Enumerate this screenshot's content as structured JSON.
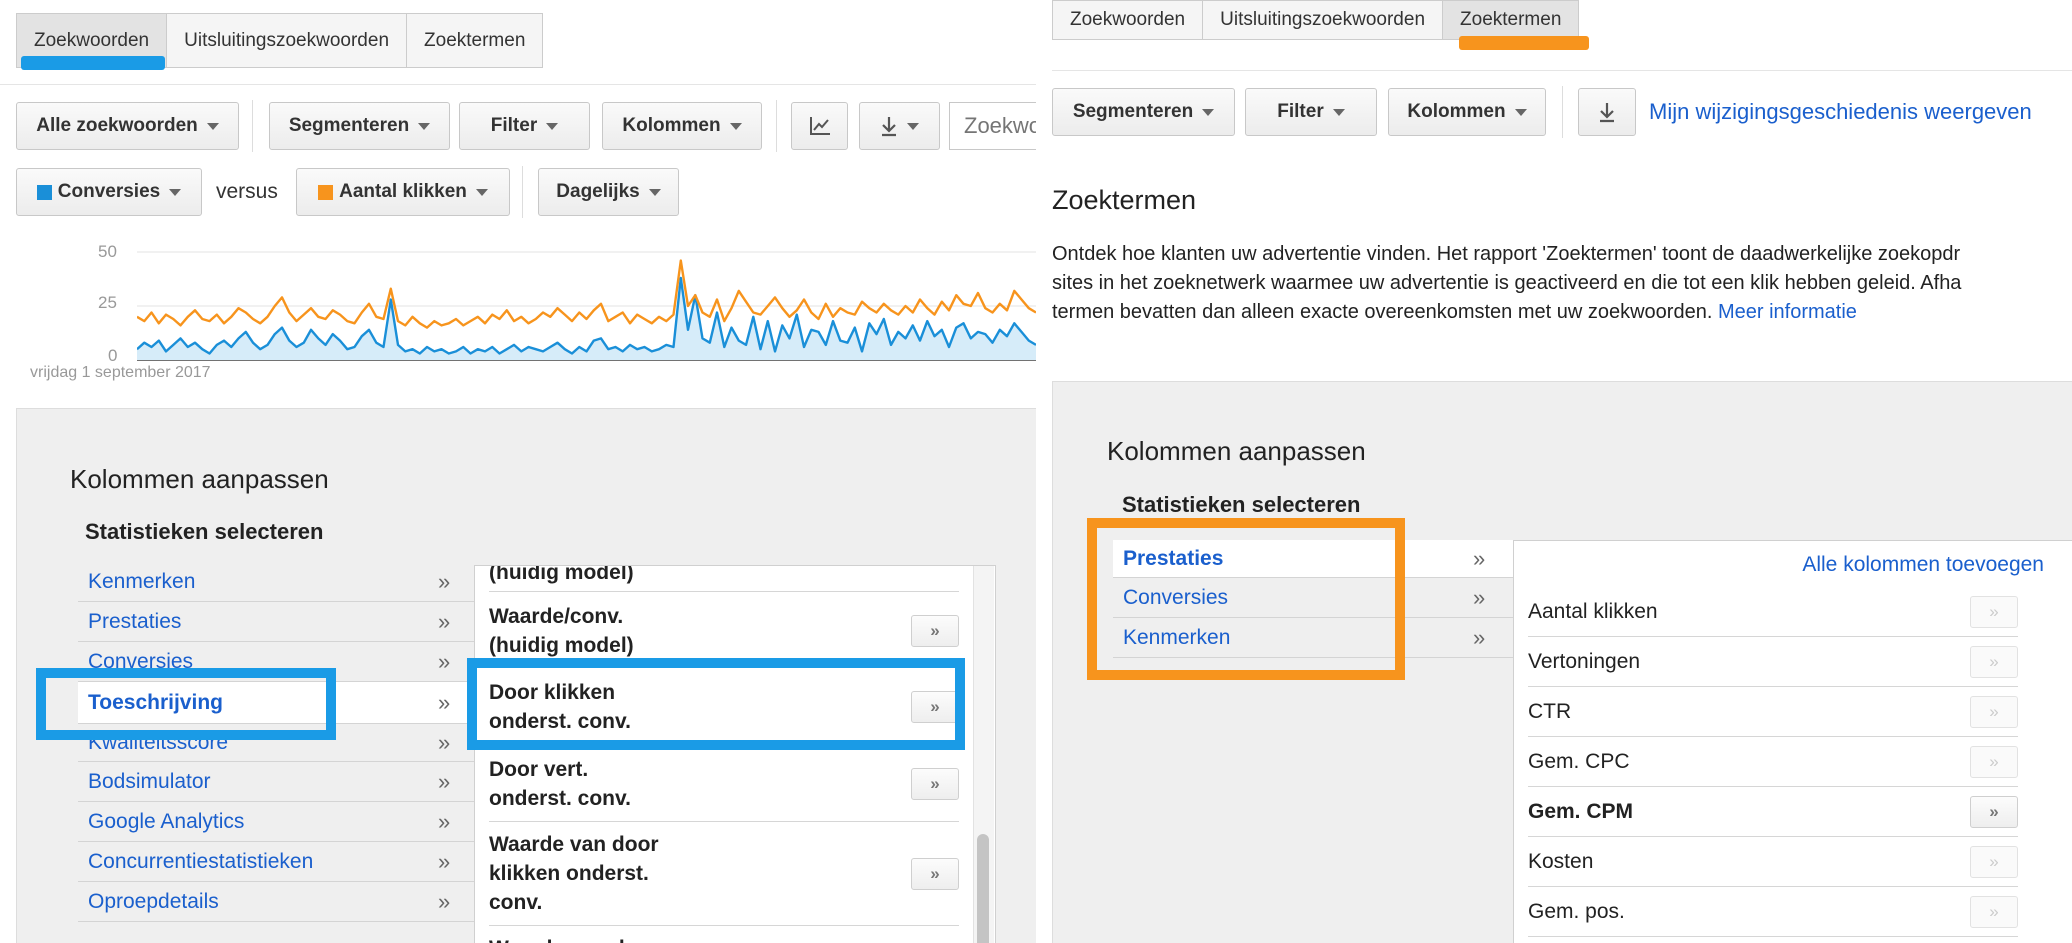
{
  "left": {
    "tabs": [
      "Zoekwoorden",
      "Uitsluitingszoekwoorden",
      "Zoektermen"
    ],
    "toolbar": {
      "all_keywords": "Alle zoekwoorden",
      "segment": "Segmenteren",
      "filter": "Filter",
      "columns": "Kolommen",
      "search_placeholder": "Zoekwo"
    },
    "metric1": "Conversies",
    "versus": "versus",
    "metric2": "Aantal klikken",
    "period": "Dagelijks",
    "chart_date": "vrijdag 1 september 2017",
    "customize": {
      "title": "Kolommen aanpassen",
      "subtitle": "Statistieken selecteren",
      "categories": [
        "Kenmerken",
        "Prestaties",
        "Conversies",
        "Toeschrijving",
        "Kwaliteitsscore",
        "Bodsimulator",
        "Google Analytics",
        "Concurrentiestatistieken",
        "Oproepdetails"
      ],
      "metrics": [
        "(huidig model)",
        "Waarde/conv.\n(huidig model)",
        "Door klikken\nonderst. conv.",
        "Door vert.\nonderst. conv.",
        "Waarde van door\nklikken onderst.\nconv.",
        "Waarde van door"
      ],
      "arrow": "»",
      "add": "»"
    }
  },
  "right": {
    "tabs": [
      "Zoekwoorden",
      "Uitsluitingszoekwoorden",
      "Zoektermen"
    ],
    "toolbar": {
      "segment": "Segmenteren",
      "filter": "Filter",
      "columns": "Kolommen",
      "history_link": "Mijn wijzigingsgeschiedenis weergeven"
    },
    "section_title": "Zoektermen",
    "description_lines": [
      "Ontdek hoe klanten uw advertentie vinden. Het rapport 'Zoektermen' toont de daadwerkelijke zoekopdr",
      "sites in het zoeknetwerk waarmee uw advertentie is geactiveerd en die tot een klik hebben geleid. Afha",
      "termen bevatten dan alleen exacte overeenkomsten met uw zoekwoorden."
    ],
    "more_info": "Meer informatie",
    "customize": {
      "title": "Kolommen aanpassen",
      "subtitle": "Statistieken selecteren",
      "categories": [
        "Prestaties",
        "Conversies",
        "Kenmerken"
      ],
      "add_all": "Alle kolommen toevoegen",
      "metrics": [
        "Aantal klikken",
        "Vertoningen",
        "CTR",
        "Gem. CPC",
        "Gem. CPM",
        "Kosten",
        "Gem. pos."
      ],
      "arrow": "»",
      "add": "»"
    }
  },
  "chart_data": {
    "type": "line",
    "title": "",
    "xlabel": "vrijdag 1 september 2017",
    "ylabel": "",
    "ylim": [
      0,
      50
    ],
    "yticks": [
      "0",
      "25",
      "50"
    ],
    "series": [
      {
        "name": "Aantal klikken",
        "color": "#f7941d",
        "values": [
          20,
          18,
          22,
          17,
          21,
          19,
          16,
          20,
          23,
          19,
          18,
          21,
          17,
          20,
          24,
          22,
          19,
          17,
          20,
          25,
          29,
          22,
          18,
          21,
          24,
          20,
          19,
          23,
          21,
          18,
          17,
          22,
          26,
          20,
          19,
          33,
          18,
          16,
          20,
          17,
          15,
          18,
          16,
          17,
          19,
          16,
          18,
          20,
          17,
          21,
          19,
          23,
          18,
          20,
          17,
          19,
          22,
          20,
          24,
          21,
          18,
          22,
          19,
          23,
          26,
          18,
          20,
          22,
          17,
          21,
          19,
          17,
          20,
          18,
          21,
          46,
          25,
          30,
          22,
          20,
          28,
          18,
          24,
          32,
          27,
          22,
          21,
          25,
          29,
          24,
          20,
          23,
          28,
          22,
          19,
          26,
          20,
          24,
          22,
          21,
          27,
          24,
          22,
          26,
          23,
          21,
          25,
          22,
          28,
          24,
          21,
          27,
          23,
          30,
          26,
          25,
          31,
          24,
          22,
          26,
          23,
          32,
          28,
          24,
          22
        ]
      },
      {
        "name": "Conversies",
        "color": "#1a8fd8",
        "values": [
          5,
          8,
          6,
          9,
          4,
          7,
          10,
          6,
          8,
          5,
          3,
          7,
          9,
          6,
          10,
          13,
          8,
          5,
          7,
          12,
          15,
          9,
          6,
          8,
          14,
          10,
          7,
          12,
          9,
          5,
          6,
          11,
          14,
          8,
          6,
          28,
          7,
          4,
          5,
          3,
          6,
          4,
          5,
          3,
          4,
          6,
          3,
          5,
          4,
          6,
          3,
          5,
          7,
          4,
          6,
          5,
          4,
          6,
          8,
          5,
          3,
          6,
          4,
          9,
          10,
          5,
          6,
          4,
          7,
          5,
          6,
          4,
          5,
          7,
          6,
          38,
          14,
          30,
          10,
          8,
          22,
          6,
          15,
          9,
          7,
          20,
          5,
          18,
          4,
          16,
          10,
          21,
          6,
          14,
          13,
          7,
          18,
          9,
          8,
          15,
          4,
          17,
          12,
          19,
          7,
          13,
          10,
          16,
          9,
          18,
          11,
          14,
          6,
          15,
          17,
          10,
          13,
          12,
          8,
          14,
          11,
          17,
          13,
          9,
          7
        ]
      }
    ]
  },
  "colors": {
    "blue_highlight": "#1a9be6",
    "orange_highlight": "#f7941d",
    "link": "#1a5fcd"
  }
}
